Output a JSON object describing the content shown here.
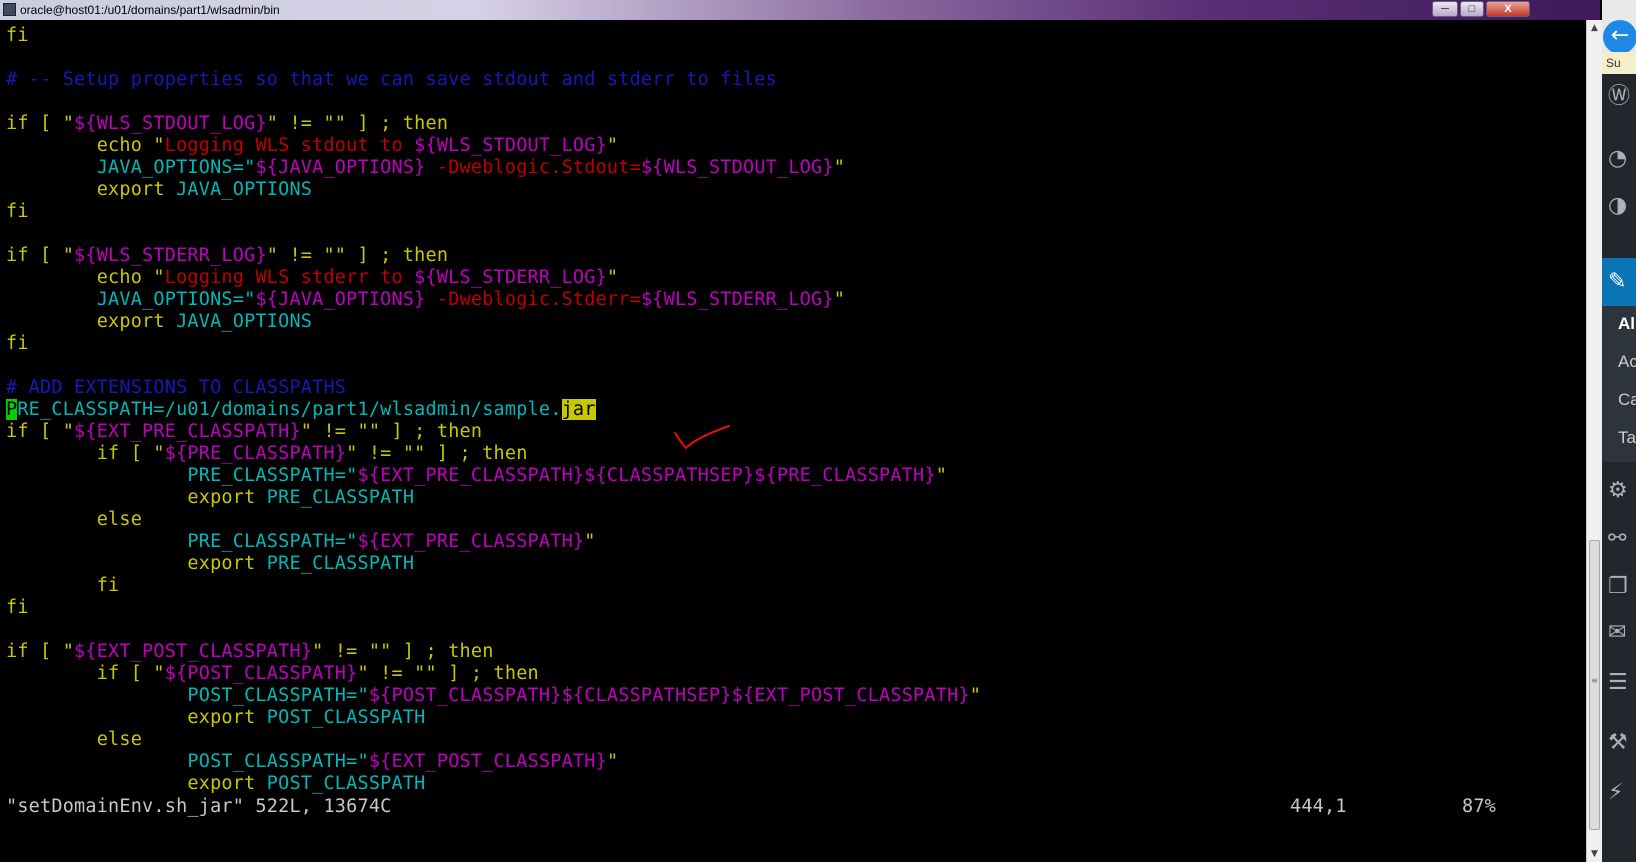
{
  "window": {
    "title": "oracle@host01:/u01/domains/part1/wlsadmin/bin",
    "minimize": "─",
    "maximize": "□",
    "close": "X"
  },
  "editor": {
    "l1": "fi",
    "l2": "# -- Setup properties so that we can save stdout and stderr to files",
    "l4a": "if [ \"",
    "l4b": "${WLS_STDOUT_LOG}",
    "l4c": "\" != \"\" ] ; then",
    "l5a": "        echo \"",
    "l5b": "Logging WLS stdout to ",
    "l5c": "${WLS_STDOUT_LOG}",
    "l5d": "\"",
    "l6a": "        JAVA_OPTIONS=\"",
    "l6b": "${JAVA_OPTIONS}",
    "l6c": " -Dweblogic.Stdout=",
    "l6d": "${WLS_STDOUT_LOG}",
    "l6e": "\"",
    "l7a": "        export ",
    "l7b": "JAVA_OPTIONS",
    "l8": "fi",
    "l10a": "if [ \"",
    "l10b": "${WLS_STDERR_LOG}",
    "l10c": "\" != \"\" ] ; then",
    "l11a": "        echo \"",
    "l11b": "Logging WLS stderr to ",
    "l11c": "${WLS_STDERR_LOG}",
    "l11d": "\"",
    "l12a": "        JAVA_OPTIONS=\"",
    "l12b": "${JAVA_OPTIONS}",
    "l12c": " -Dweblogic.Stderr=",
    "l12d": "${WLS_STDERR_LOG}",
    "l12e": "\"",
    "l13a": "        export ",
    "l13b": "JAVA_OPTIONS",
    "l14": "fi",
    "l16": "# ADD EXTENSIONS TO CLASSPATHS",
    "l17cur": "P",
    "l17a": "RE_CLASSPATH=/u01/domains/part1/wlsadmin/sample.",
    "l17hl": "jar",
    "l18a": "if [ \"",
    "l18b": "${EXT_PRE_CLASSPATH}",
    "l18c": "\" != \"\" ] ; then",
    "l19a": "        if [ \"",
    "l19b": "${PRE_CLASSPATH}",
    "l19c": "\" != \"\" ] ; then",
    "l20a": "                PRE_CLASSPATH=\"",
    "l20b": "${EXT_PRE_CLASSPATH}${CLASSPATHSEP}${PRE_CLASSPATH}",
    "l20c": "\"",
    "l21a": "                export ",
    "l21b": "PRE_CLASSPATH",
    "l22": "        else",
    "l23a": "                PRE_CLASSPATH=\"",
    "l23b": "${EXT_PRE_CLASSPATH}",
    "l23c": "\"",
    "l24a": "                export ",
    "l24b": "PRE_CLASSPATH",
    "l25": "        fi",
    "l26": "fi",
    "l28a": "if [ \"",
    "l28b": "${EXT_POST_CLASSPATH}",
    "l28c": "\" != \"\" ] ; then",
    "l29a": "        if [ \"",
    "l29b": "${POST_CLASSPATH}",
    "l29c": "\" != \"\" ] ; then",
    "l30a": "                POST_CLASSPATH=\"",
    "l30b": "${POST_CLASSPATH}${CLASSPATHSEP}${EXT_POST_CLASSPATH}",
    "l30c": "\"",
    "l31a": "                export ",
    "l31b": "POST_CLASSPATH",
    "l32": "        else",
    "l33a": "                POST_CLASSPATH=\"",
    "l33b": "${EXT_POST_CLASSPATH}",
    "l33c": "\"",
    "l34a": "                export ",
    "l34b": "POST_CLASSPATH"
  },
  "status": {
    "file": "\"setDomainEnv.sh_jar\" 522L, 13674C",
    "position": "444,1",
    "percent": "87%"
  },
  "side_panel": {
    "tab_label": "Su",
    "menu_items": [
      "Al",
      "Ac",
      "Ca",
      "Ta"
    ]
  },
  "colors": {
    "keyword": "#c8c800",
    "variable": "#c000c0",
    "string": "#c00000",
    "identifier": "#00b8b8",
    "comment": "#1818b8",
    "cursor": "#00d000"
  }
}
